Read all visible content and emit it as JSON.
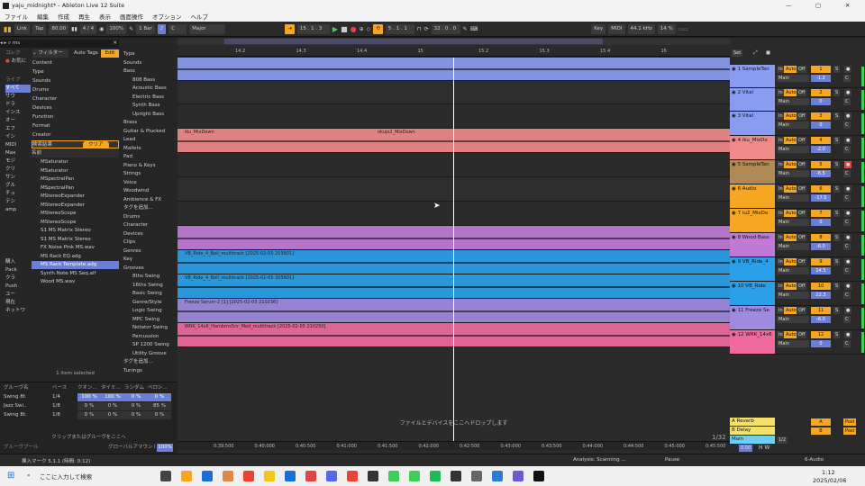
{
  "window": {
    "title": "yaju_midnight* - Ableton Live 12 Suite",
    "controls": [
      "—",
      "▢",
      "✕"
    ]
  },
  "menu": [
    "ファイル",
    "編集",
    "作成",
    "再生",
    "表示",
    "画面操作",
    "オプション",
    "ヘルプ"
  ],
  "transport": {
    "link": "Link",
    "tap": "Tap",
    "tempo": "80.00",
    "meter": "4 / 4",
    "zoom": "100%",
    "quant": "1 Bar",
    "key": "C",
    "scale": "Major",
    "position": "15 . 1 . 3",
    "loop_start": "5 . 1 . 1",
    "loop_len": "32 . 0 . 0",
    "key_btn": "Key",
    "midi_btn": "MIDI",
    "sample_rate": "44.1 kHz",
    "cpu": "14 %"
  },
  "browser": {
    "search_value": "ms",
    "filter_label": "フィルター",
    "auto_tags": "Auto Tags",
    "edit": "Edit",
    "collections_label": "コレク",
    "fav_label": "お気に",
    "library_label": "ライブ",
    "results_label": "検索結果",
    "clear_label": "クリア",
    "name_header": "名前",
    "places": [
      "すべて",
      "サウ",
      "ドラ",
      "インス",
      "オー",
      "エフ",
      "イン",
      "MIDI",
      "Max",
      "モジ",
      "クリ",
      "サン",
      "グル",
      "チュ",
      "テン",
      "amp"
    ],
    "places2": [
      "購入",
      "Pack",
      "クラ",
      "Push",
      "ユー",
      "現在",
      "ネットワ"
    ],
    "filter_tags": [
      "Content",
      "Type",
      "Sounds",
      "Drums",
      "Character",
      "Devices",
      "Function",
      "Format",
      "Creator"
    ],
    "results": [
      "MSaturator",
      "MSaturator",
      "MSpectralPan",
      "MSpectralPan",
      "MStereoExpander",
      "MStereoExpander",
      "MStereoScope",
      "MStereoScope",
      "S1 MS Matrix Stereo",
      "S1 MS Matrix Stereo",
      "FX Noise Pink MS.wav",
      "MS Rack EQ.adg",
      "MS Rack Template.adg",
      "Synth Note MS Seq.alf",
      "Wood MS.wav"
    ],
    "selected_result": "MS Rack Template.adg",
    "items_selected": "1 item selected",
    "tag_column": [
      "Type",
      "Sounds",
      "Bass",
      "808 Bass",
      "Acoustic Bass",
      "Electric Bass",
      "Synth Bass",
      "Upright Bass",
      "Brass",
      "Guitar & Plucked",
      "Lead",
      "Mallets",
      "Pad",
      "Piano & Keys",
      "Strings",
      "Voice",
      "Woodwind",
      "Ambience & FX",
      "タグを追加...",
      "Drums",
      "Character",
      "Devices",
      "Clips",
      "Genres",
      "Key",
      "Grooves",
      "8ths Swing",
      "16ths Swing",
      "Basic Swing",
      "Genre/Style",
      "Logic Swing",
      "MPC Swing",
      "Notator Swing",
      "Percussion",
      "SP 1200 Swing",
      "Utility Groove",
      "タグを追加...",
      "Tunings"
    ]
  },
  "groove": {
    "headers": [
      "グルーヴ名",
      "ベース",
      "クオン...",
      "タイミ...",
      "ランダム",
      "ベロシ..."
    ],
    "rows": [
      [
        "Swing 8t...",
        "1/4",
        "100 %",
        "100 %",
        "0 %",
        "0 %"
      ],
      [
        "Jazz Swi...",
        "1/8",
        "0 %",
        "0 %",
        "0 %",
        "85 %"
      ],
      [
        "Swing 8t...",
        "1/8",
        "0 %",
        "0 %",
        "0 %",
        "0 %"
      ]
    ],
    "drop_hint": "クリップまたはグルーヴをここへ",
    "pool_label": "グルーヴプール",
    "global_amount_label": "グローバルアマウント",
    "global_amount": "100%"
  },
  "arrangement": {
    "ruler": [
      "14.2",
      "14.3",
      "14.4",
      "15",
      "15.2",
      "15.3",
      "15.4",
      "16"
    ],
    "time_ruler": [
      "0:39:500",
      "0:40:000",
      "0:40:500",
      "0:41:000",
      "0:41:500",
      "0:42:000",
      "0:42:500",
      "0:43:000",
      "0:43:500",
      "0:44:000",
      "0:44:500",
      "0:45:000",
      "0:45:500"
    ],
    "drop_text": "ファイルとデバイスをここへドロップします",
    "grid_quant": "1/32",
    "clip_names": [
      "iku_MixDown",
      "okujo2_MixDown",
      "VB_Ride_4_Bell_multitrack [2025-02-05 205601]",
      "VB_Ride_4_Bell_multitrack [2025-02-05 205601]",
      "Freeze Serum-2 [1] [2025-02-05 210236]",
      "WRK_14x6_Hambrns5nr_Med_multitrack [2025-02-05 210250]"
    ]
  },
  "tracks": [
    {
      "name": "1 SampleTan",
      "num": "1",
      "color": "#8a9cf0",
      "vol": "-1.2"
    },
    {
      "name": "2 Vital",
      "num": "2",
      "color": "#8a9cf0",
      "vol": "0"
    },
    {
      "name": "3 Vital",
      "num": "3",
      "color": "#8a9cf0",
      "vol": "0"
    },
    {
      "name": "4 iku_MixDo",
      "num": "4",
      "color": "#f08a8a",
      "vol": "-2.0"
    },
    {
      "name": "5 SampleTan",
      "num": "5",
      "color": "#b08a55",
      "vol": "-6.5"
    },
    {
      "name": "6 Audio",
      "num": "6",
      "color": "#f5a623",
      "vol": "-17.5"
    },
    {
      "name": "7 iu2_MixDo",
      "num": "7",
      "color": "#f5a623",
      "vol": "0"
    },
    {
      "name": "8 Wood Bass",
      "num": "8",
      "color": "#c07ad6",
      "vol": "-6.0"
    },
    {
      "name": "9 VB_Ride_4",
      "num": "9",
      "color": "#2aa0e8",
      "vol": "14.5"
    },
    {
      "name": "10 VB_Ride",
      "num": "10",
      "color": "#2aa0e8",
      "vol": "22.3"
    },
    {
      "name": "11 Freeze Se",
      "num": "11",
      "color": "#9f8ae0",
      "vol": "-6.0"
    },
    {
      "name": "12 WRK_14x6",
      "num": "12",
      "color": "#f06aa0",
      "vol": "0"
    }
  ],
  "returns": [
    {
      "name": "A Reverb",
      "letter": "A"
    },
    {
      "name": "B Delay",
      "letter": "B"
    }
  ],
  "main": {
    "name": "Main",
    "sel": "1/2",
    "vol": "0.00",
    "set_label": "Set"
  },
  "status": {
    "left": "挿入マーク 5.1.1 (時間: 0:12)",
    "center": "Analysis: Scanning ...",
    "pause": "Pause",
    "right": "6-Audio"
  },
  "taskbar": {
    "search": "ここに入力して検索",
    "time": "1:12",
    "date": "2025/02/06"
  },
  "colors": {
    "accent": "#f5a623",
    "selection": "#6b7fd7"
  }
}
